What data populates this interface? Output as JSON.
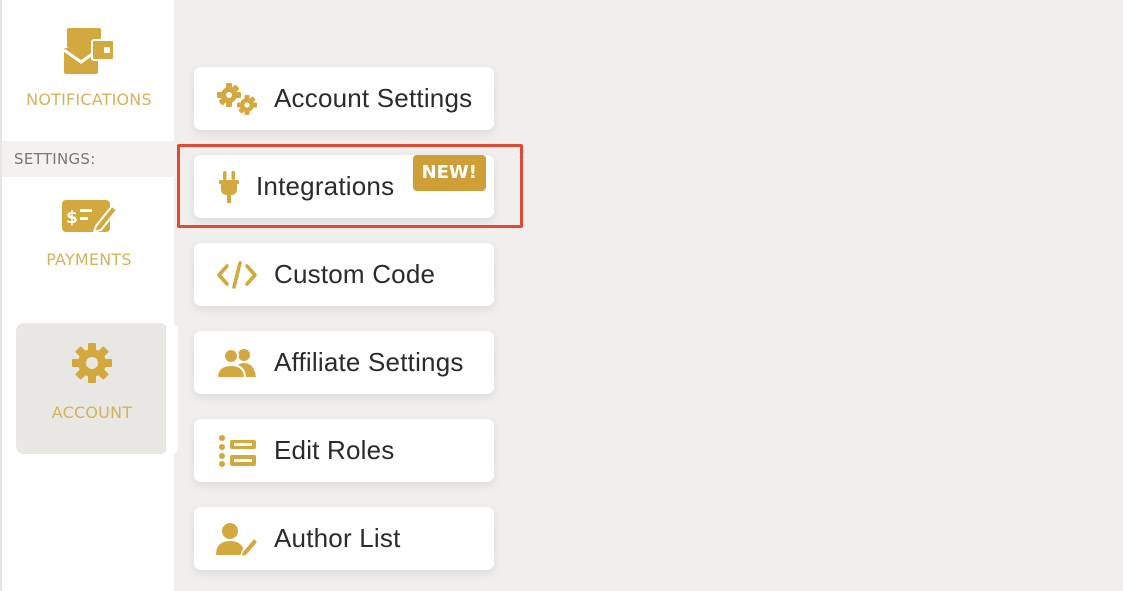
{
  "sidebar": {
    "notifications_label": "NOTIFICATIONS",
    "section_label": "SETTINGS:",
    "payments_label": "PAYMENTS",
    "account_label": "ACCOUNT"
  },
  "menu": {
    "items": [
      {
        "label": "Account Settings",
        "icon": "gears-icon"
      },
      {
        "label": "Integrations",
        "icon": "plug-icon",
        "badge": "NEW!"
      },
      {
        "label": "Custom Code",
        "icon": "code-icon"
      },
      {
        "label": "Affiliate Settings",
        "icon": "users-icon"
      },
      {
        "label": "Edit Roles",
        "icon": "list-icon"
      },
      {
        "label": "Author List",
        "icon": "user-edit-icon"
      }
    ]
  },
  "colors": {
    "accent": "#d3a93f",
    "badge": "#cf9e36",
    "highlight": "#e34a33",
    "background": "#f0efed"
  }
}
